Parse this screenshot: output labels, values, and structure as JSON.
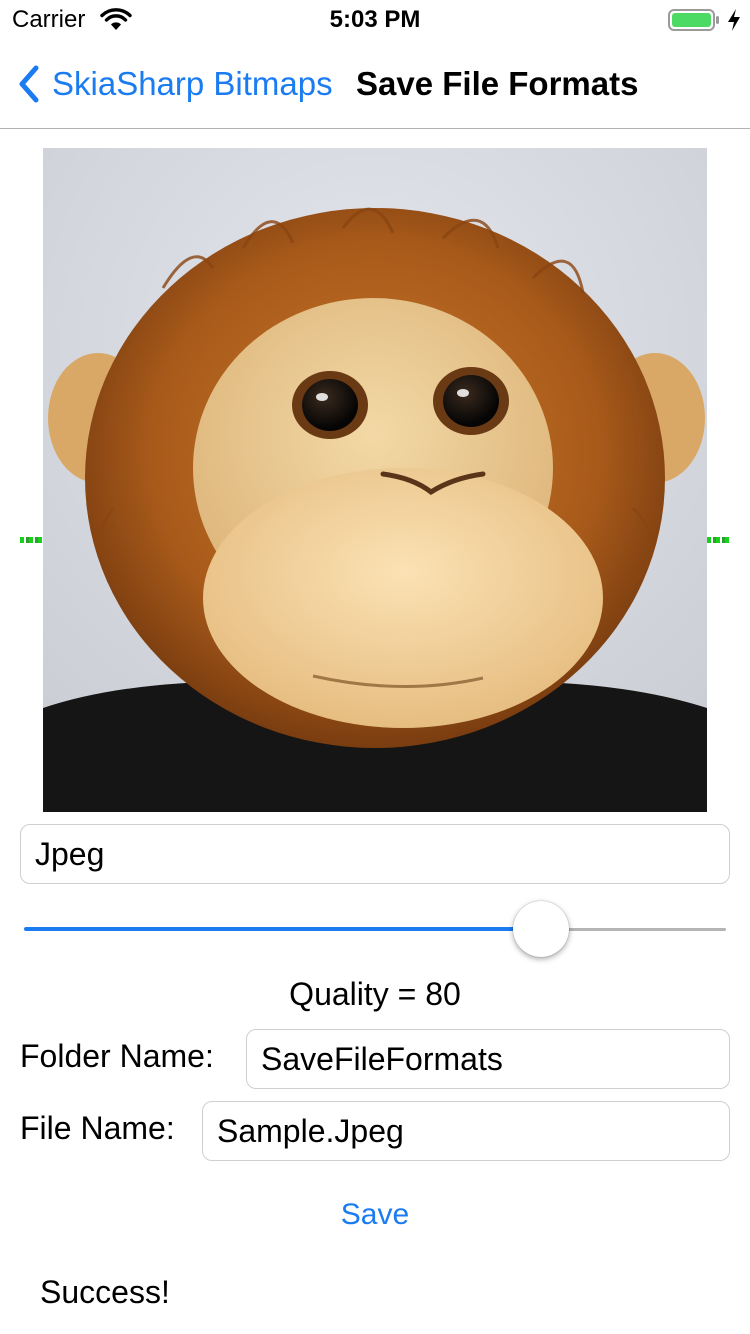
{
  "status_bar": {
    "carrier": "Carrier",
    "time": "5:03 PM",
    "battery_color": "#4cd964",
    "icons": [
      "wifi-icon",
      "battery-icon",
      "charging-icon"
    ]
  },
  "nav": {
    "back_label": "SkiaSharp Bitmaps",
    "title": "Save File Formats",
    "accent_color": "#1a7cf0"
  },
  "image": {
    "subject": "stuffed monkey photo"
  },
  "format_picker": {
    "value": "Jpeg"
  },
  "quality_slider": {
    "value": 80,
    "min": 0,
    "max": 100
  },
  "quality_text": "Quality = 80",
  "folder": {
    "label": "Folder Name:",
    "value": "SaveFileFormats"
  },
  "file": {
    "label": "File Name:",
    "value": "Sample.Jpeg"
  },
  "save_label": "Save",
  "status_message": "Success!"
}
